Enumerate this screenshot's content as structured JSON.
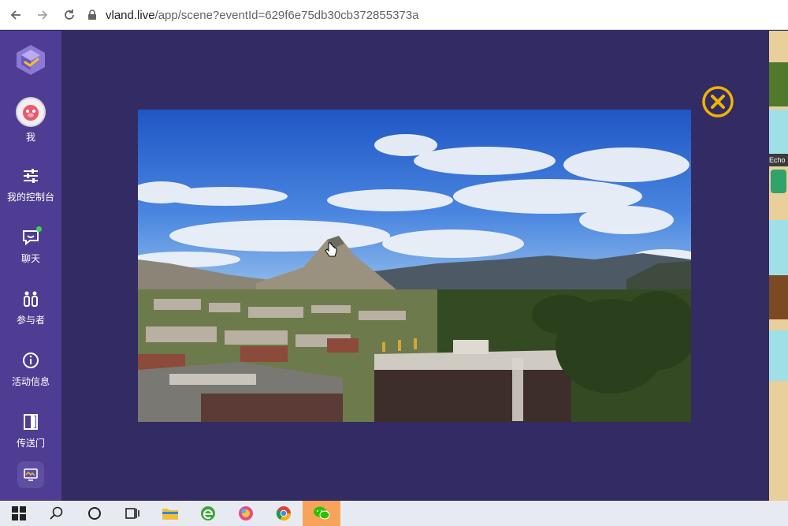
{
  "browser": {
    "url_host": "vland.live",
    "url_path": "/app/scene?eventId=629f6e75db30cb372855373a",
    "back_icon": "arrow-left-icon",
    "forward_icon": "arrow-right-icon",
    "reload_icon": "reload-icon",
    "lock_icon": "lock-icon"
  },
  "sidebar": {
    "items": [
      {
        "label": "我",
        "icon": "avatar"
      },
      {
        "label": "我的控制台",
        "icon": "sliders-icon"
      },
      {
        "label": "聊天",
        "icon": "chat-icon"
      },
      {
        "label": "参与者",
        "icon": "participants-icon"
      },
      {
        "label": "活动信息",
        "icon": "info-icon"
      },
      {
        "label": "传送门",
        "icon": "portal-icon"
      }
    ],
    "accent": "#4f3d93"
  },
  "main": {
    "close_icon": "close-circle-icon",
    "close_color": "#f0b400"
  },
  "right_strip": {
    "partial_name": "Echo"
  },
  "taskbar": {
    "icons": [
      "windows-start-icon",
      "search-icon",
      "cortana-icon",
      "task-view-icon",
      "file-explorer-icon",
      "edge-icon",
      "photos-icon",
      "chrome-icon",
      "wechat-icon"
    ]
  }
}
